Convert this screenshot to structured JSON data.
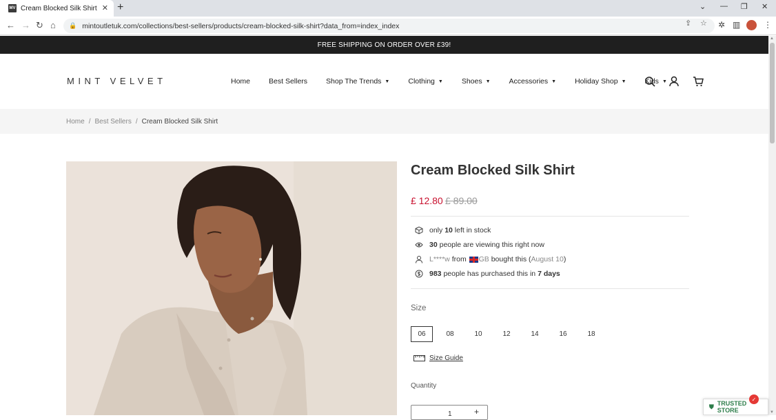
{
  "browser": {
    "tab_title": "Cream Blocked Silk Shirt",
    "favicon_text": "MV",
    "url": "mintoutletuk.com/collections/best-sellers/products/cream-blocked-silk-shirt?data_from=index_index"
  },
  "promo_bar": "FREE SHIPPING ON ORDER OVER £39!",
  "header": {
    "logo": "MINT VELVET",
    "nav": [
      {
        "label": "Home"
      },
      {
        "label": "Best Sellers"
      },
      {
        "label": "Shop The Trends"
      },
      {
        "label": "Clothing"
      },
      {
        "label": "Shoes"
      },
      {
        "label": "Accessories"
      },
      {
        "label": "Holiday Shop"
      },
      {
        "label": "Kids"
      }
    ]
  },
  "breadcrumb": {
    "home": "Home",
    "section": "Best Sellers",
    "current": "Cream Blocked Silk Shirt",
    "separator": "/"
  },
  "product": {
    "title": "Cream Blocked Silk Shirt",
    "price_sale": "£ 12.80",
    "price_original": "£ 89.00",
    "stock": {
      "pre": "only",
      "count": "10",
      "post": "left in stock"
    },
    "viewing": {
      "count": "30",
      "post": "people are viewing this right now"
    },
    "recent": {
      "name": "L****w",
      "from": "from",
      "country": "GB",
      "action": "bought this",
      "open": "(",
      "date": "August 10",
      "close": ")"
    },
    "purchased": {
      "count": "983",
      "mid": "people has purchased this in",
      "days": "7 days"
    },
    "size_label": "Size",
    "sizes": [
      "06",
      "08",
      "10",
      "12",
      "14",
      "16",
      "18"
    ],
    "size_selected": "06",
    "size_guide": "Size Guide",
    "quantity_label": "Quantity",
    "quantity_value": "1",
    "quantity_plus": "+"
  },
  "trusted_store": "TRUSTED STORE",
  "trusted_badge": "✓",
  "colors": {
    "sale": "#c8102e",
    "promo_bg": "#1f1f1f"
  }
}
